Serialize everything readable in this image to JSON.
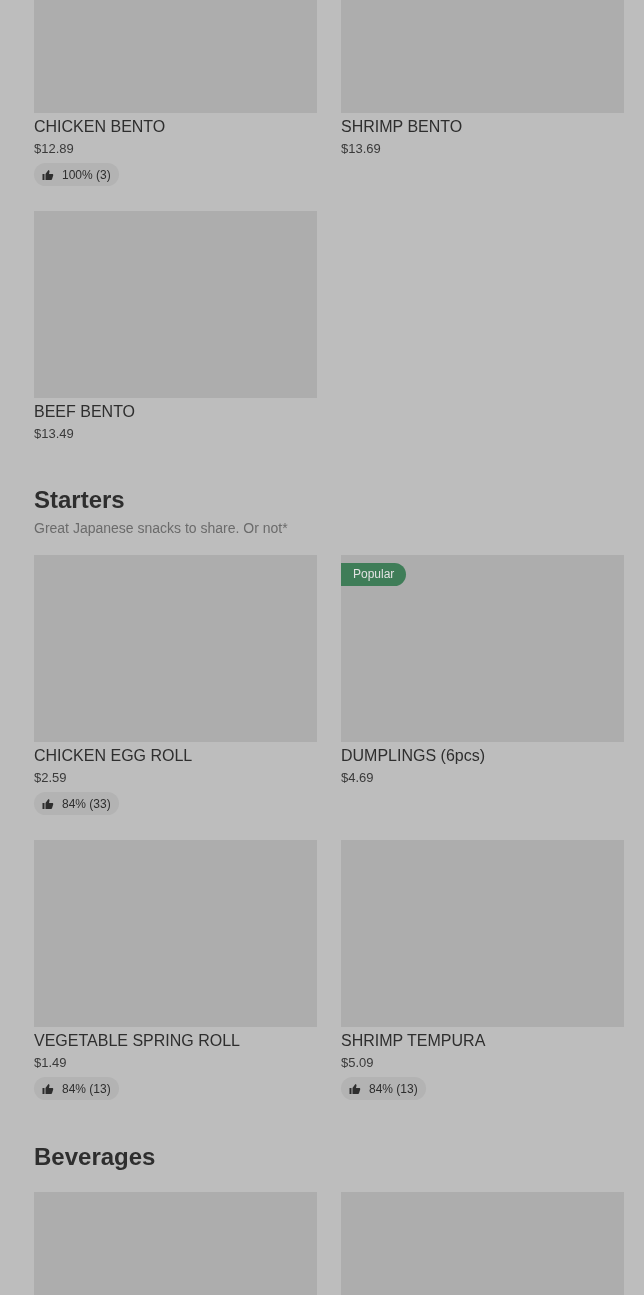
{
  "sections": [
    {
      "rows": [
        {
          "items": [
            {
              "kind": "dish",
              "name": "CHICKEN BENTO",
              "price": "$12.89",
              "rating": "100% (3)"
            },
            {
              "kind": "dish",
              "name": "SHRIMP BENTO",
              "price": "$13.69"
            }
          ]
        },
        {
          "items": [
            {
              "kind": "dish",
              "name": "BEEF BENTO",
              "price": "$13.49"
            }
          ]
        }
      ]
    },
    {
      "title": "Starters",
      "description": "Great Japanese snacks to share. Or not*",
      "rows": [
        {
          "items": [
            {
              "kind": "dish",
              "name": "CHICKEN EGG ROLL",
              "price": "$2.59",
              "rating": "84% (33)"
            },
            {
              "kind": "dish",
              "name": "DUMPLINGS (6pcs)",
              "price": "$4.69",
              "badge": "Popular"
            }
          ]
        },
        {
          "items": [
            {
              "kind": "dish",
              "name": "VEGETABLE SPRING ROLL",
              "price": "$1.49",
              "rating": "84% (13)"
            },
            {
              "kind": "dish",
              "name": "SHRIMP TEMPURA",
              "price": "$5.09",
              "rating": "84% (13)"
            }
          ]
        }
      ]
    },
    {
      "title": "Beverages"
    }
  ]
}
